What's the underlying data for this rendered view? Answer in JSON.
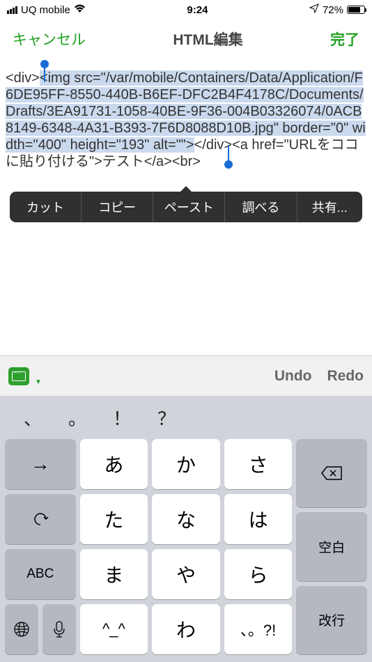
{
  "status": {
    "carrier": "UQ mobile",
    "time": "9:24",
    "battery_pct": "72%"
  },
  "nav": {
    "cancel": "キャンセル",
    "title": "HTML編集",
    "done": "完了"
  },
  "editor": {
    "before_selection": "<div>",
    "selected": "<img src=\"/var/mobile/Containers/Data/Application/F6DE95FF-8550-440B-B6EF-DFC2B4F4178C/Documents/Drafts/3EA91731-1058-40BE-9F36-004B03326074/0ACB8149-6348-4A31-B393-7F6D8088D10B.jpg\" border=\"0\" width=\"400\" height=\"193\" alt=\"\">",
    "after_selection": "</div><a href=\"URLをココに貼り付ける\">テスト</a><br>"
  },
  "context_menu": {
    "cut": "カット",
    "copy": "コピー",
    "paste": "ペースト",
    "lookup": "調べる",
    "share": "共有..."
  },
  "kb_toolbar": {
    "undo": "Undo",
    "redo": "Redo"
  },
  "suggest": [
    "、",
    "。",
    "！",
    "？"
  ],
  "keys": {
    "arrow": "→",
    "a": "あ",
    "ka": "か",
    "sa": "さ",
    "ta": "た",
    "na": "な",
    "ha": "は",
    "ma": "ま",
    "ya": "や",
    "ra": "ら",
    "dakuten": "^_^",
    "wa": "わ",
    "punct": "、。?!",
    "abc": "ABC",
    "space": "空白",
    "return": "改行",
    "undo_key": "↺",
    "globe": "🌐",
    "mic": "🎤"
  }
}
